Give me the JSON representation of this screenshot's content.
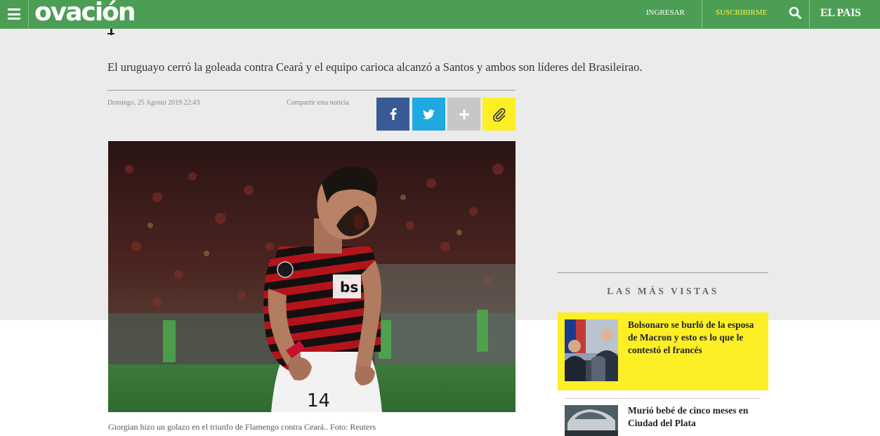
{
  "header": {
    "logo": "ovación",
    "login_label": "INGRESAR",
    "subscribe_label": "SUSCRIBIRME",
    "brand": "EL PAIS",
    "icons": [
      "menu-icon",
      "search-icon"
    ],
    "colors": {
      "bar": "#4d9e55",
      "subscribe": "#f5f044"
    }
  },
  "article": {
    "subtitle": "El uruguayo cerró la goleada contra Ceará y el equipo carioca alcanzó a Santos y ambos son líderes del Brasileirao.",
    "date": "Domingo, 25 Agosto 2019 22:43",
    "share_label": "Compartir esta noticia",
    "share_buttons": [
      {
        "name": "facebook",
        "icon": "facebook-icon",
        "color": "#385b96"
      },
      {
        "name": "twitter",
        "icon": "twitter-icon",
        "color": "#1ea9e1"
      },
      {
        "name": "more",
        "icon": "plus-icon",
        "color": "#c7c7c7"
      },
      {
        "name": "copy-link",
        "icon": "paperclip-icon",
        "color": "#fdef24"
      }
    ],
    "photo_caption": "Giorgian hizo un golazo en el triunfo de Flamengo contra Ceará.. Foto: Reuters"
  },
  "sidebar": {
    "heading": "LAS MÁS VISTAS",
    "items": [
      {
        "title": "Bolsonaro se burló de la esposa de Macron y esto es lo que le contestó el francés",
        "highlight": "#fdef26"
      },
      {
        "title": "Murió bebé de cinco meses en Ciudad del Plata"
      }
    ]
  }
}
